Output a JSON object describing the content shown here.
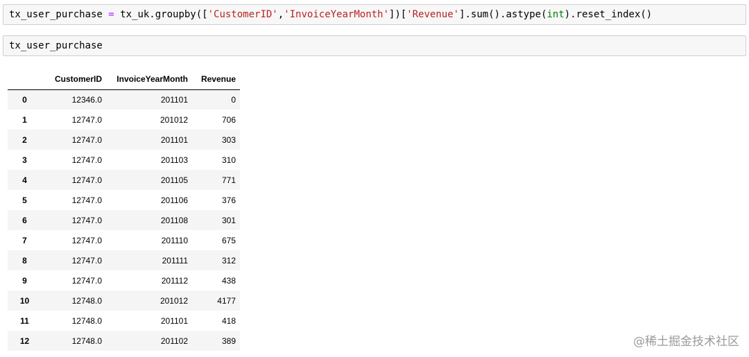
{
  "cells": [
    {
      "tokens": [
        {
          "text": "tx_user_purchase ",
          "kind": "plain"
        },
        {
          "text": "=",
          "kind": "op"
        },
        {
          "text": " tx_uk.groupby([",
          "kind": "plain"
        },
        {
          "text": "'CustomerID'",
          "kind": "str"
        },
        {
          "text": ",",
          "kind": "plain"
        },
        {
          "text": "'InvoiceYearMonth'",
          "kind": "str"
        },
        {
          "text": "])[",
          "kind": "plain"
        },
        {
          "text": "'Revenue'",
          "kind": "str"
        },
        {
          "text": "].sum().astype(",
          "kind": "plain"
        },
        {
          "text": "int",
          "kind": "builtin"
        },
        {
          "text": ").reset_index()",
          "kind": "plain"
        }
      ]
    },
    {
      "tokens": [
        {
          "text": "tx_user_purchase",
          "kind": "plain"
        }
      ]
    }
  ],
  "table": {
    "columns": [
      "CustomerID",
      "InvoiceYearMonth",
      "Revenue"
    ],
    "rows": [
      {
        "index": "0",
        "cells": [
          "12346.0",
          "201101",
          "0"
        ]
      },
      {
        "index": "1",
        "cells": [
          "12747.0",
          "201012",
          "706"
        ]
      },
      {
        "index": "2",
        "cells": [
          "12747.0",
          "201101",
          "303"
        ]
      },
      {
        "index": "3",
        "cells": [
          "12747.0",
          "201103",
          "310"
        ]
      },
      {
        "index": "4",
        "cells": [
          "12747.0",
          "201105",
          "771"
        ]
      },
      {
        "index": "5",
        "cells": [
          "12747.0",
          "201106",
          "376"
        ]
      },
      {
        "index": "6",
        "cells": [
          "12747.0",
          "201108",
          "301"
        ]
      },
      {
        "index": "7",
        "cells": [
          "12747.0",
          "201110",
          "675"
        ]
      },
      {
        "index": "8",
        "cells": [
          "12747.0",
          "201111",
          "312"
        ]
      },
      {
        "index": "9",
        "cells": [
          "12747.0",
          "201112",
          "438"
        ]
      },
      {
        "index": "10",
        "cells": [
          "12748.0",
          "201012",
          "4177"
        ]
      },
      {
        "index": "11",
        "cells": [
          "12748.0",
          "201101",
          "418"
        ]
      },
      {
        "index": "12",
        "cells": [
          "12748.0",
          "201102",
          "389"
        ]
      }
    ]
  },
  "watermark": "@稀土掘金技术社区",
  "colors": {
    "string": "#ba2121",
    "operator": "#aa22ff",
    "builtin": "#008000",
    "cell_bg": "#f7f7f7",
    "cell_border": "#cfcfcf",
    "stripe": "#f5f5f5"
  }
}
